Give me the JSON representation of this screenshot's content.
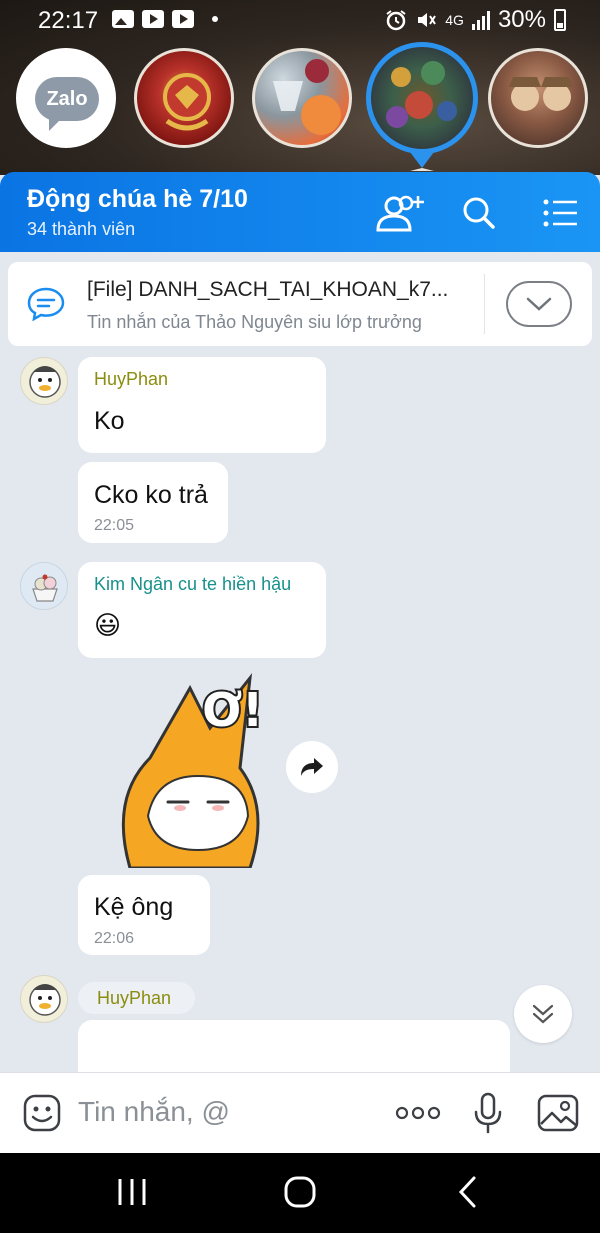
{
  "status_bar": {
    "time": "22:17",
    "network": "4G",
    "battery": "30%"
  },
  "bubbles": {
    "zalo_logo": "Zalo"
  },
  "header": {
    "title": "Động chúa hè 7/10",
    "members": "34 thành viên"
  },
  "pinned": {
    "title": "[File] DANH_SACH_TAI_KHOAN_k7...",
    "subtitle": "Tin nhắn của Thảo Nguyên siu lớp trưởng"
  },
  "messages": [
    {
      "sender": "HuyPhan",
      "text": "Ko"
    },
    {
      "text": "Cko ko trả",
      "time": "22:05"
    },
    {
      "sender": "Kim Ngân cu te hiền hậu",
      "text": "😃"
    },
    {
      "text": "Kệ ông",
      "time": "22:06"
    },
    {
      "sender": "HuyPhan"
    }
  ],
  "sticker": {
    "text": "Ơ!"
  },
  "input": {
    "placeholder": "Tin nhắn, @"
  },
  "colors": {
    "primary": "#0a74e3",
    "chat_bg": "#e3e8ef",
    "sender_olive": "#8b8d10",
    "sender_teal": "#17918a"
  }
}
